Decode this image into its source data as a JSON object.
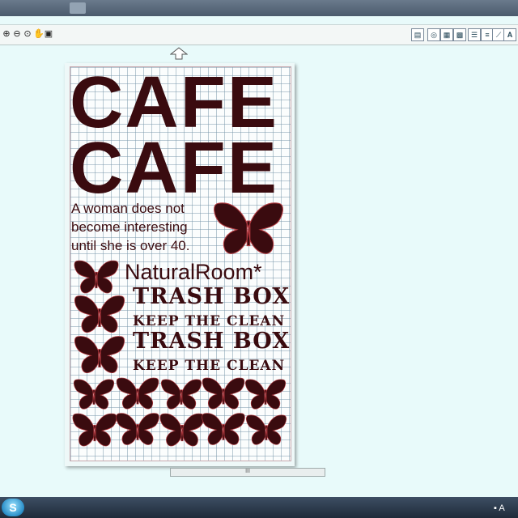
{
  "toolbar": {
    "left_tools": [
      "zoom-in-icon",
      "zoom-out-icon",
      "zoom-fit-icon",
      "pan-icon",
      "page-icon"
    ],
    "right_tools": [
      "save-icon",
      "mat-icon",
      "preview-icon",
      "grid-icon",
      "align-icon",
      "lines-icon",
      "knife-icon",
      "text-icon"
    ],
    "text_tool_label": "A"
  },
  "design": {
    "cafe_line_1": "CAFE",
    "cafe_line_2": "CAFE",
    "quote_line_1": "A woman does not",
    "quote_line_2": "become interesting",
    "quote_line_3": "until she is over 40.",
    "natural_room": "NaturalRoom*",
    "trash_box_1": "TRASH BOX",
    "keep_clean_1": "KEEP THE CLEAN",
    "trash_box_2": "TRASH BOX",
    "keep_clean_2": "KEEP THE CLEAN"
  },
  "scrollbar": {
    "grip": "III"
  },
  "taskbar": {
    "start_glyph": "S",
    "tray_text": "A"
  },
  "colors": {
    "ink": "#3a0b0f",
    "canvas": "#e8fafa",
    "mat_border": "#c7a7ac"
  }
}
